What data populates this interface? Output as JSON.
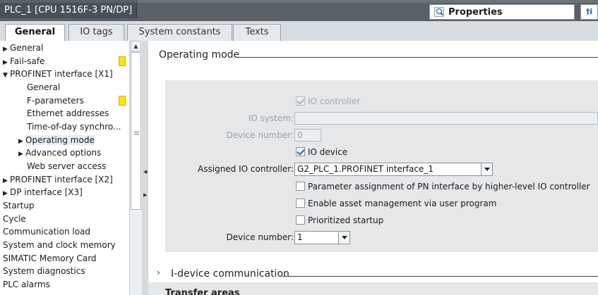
{
  "window": {
    "title": "PLC_1 [CPU 1516F-3 PN/DP]",
    "properties_label": "Properties",
    "info_glyph": "†i"
  },
  "tabs": [
    {
      "label": "General",
      "active": true
    },
    {
      "label": "IO tags",
      "active": false
    },
    {
      "label": "System constants",
      "active": false
    },
    {
      "label": "Texts",
      "active": false
    }
  ],
  "nav": {
    "items": [
      {
        "label": "General",
        "arrow": "▶"
      },
      {
        "label": "Fail-safe",
        "arrow": "▶"
      },
      {
        "label": "PROFINET interface [X1]",
        "arrow": "▼"
      },
      {
        "label": "General",
        "arrow": ""
      },
      {
        "label": "F-parameters",
        "arrow": ""
      },
      {
        "label": "Ethernet addresses",
        "arrow": ""
      },
      {
        "label": "Time-of-day synchro...",
        "arrow": ""
      },
      {
        "label": "Operating mode",
        "arrow": "▶"
      },
      {
        "label": "Advanced options",
        "arrow": "▶"
      },
      {
        "label": "Web server access",
        "arrow": ""
      },
      {
        "label": "PROFINET interface [X2]",
        "arrow": "▶"
      },
      {
        "label": "DP interface [X3]",
        "arrow": "▶"
      },
      {
        "label": "Startup",
        "arrow": ""
      },
      {
        "label": "Cycle",
        "arrow": ""
      },
      {
        "label": "Communication load",
        "arrow": ""
      },
      {
        "label": "System and clock memory",
        "arrow": ""
      },
      {
        "label": "SIMATIC Memory Card",
        "arrow": ""
      },
      {
        "label": "System diagnostics",
        "arrow": ""
      },
      {
        "label": "PLC alarms",
        "arrow": ""
      }
    ]
  },
  "icons": {
    "scroll_up": "▲",
    "splitter_left": "◀",
    "splitter_right": "▶",
    "section_chevron": "›"
  },
  "main": {
    "operating_mode_title": "Operating mode",
    "io_controller_label": "IO controller",
    "io_system_label": "IO system:",
    "io_system_value": "",
    "device_number_label": "Device number:",
    "device_number_value_disabled": "0",
    "io_device_label": "IO device",
    "assigned_io_controller_label": "Assigned IO controller:",
    "assigned_io_controller_value": "G2_PLC_1.PROFINET interface_1",
    "param_assignment_label": "Parameter assignment of PN interface by higher-level IO controller",
    "asset_mgmt_label": "Enable asset management via user program",
    "prioritized_startup_label": "Prioritized startup",
    "device_number2_label": "Device number:",
    "device_number2_value": "1",
    "idevice_comm_title": "I-device communication",
    "transfer_areas_title": "Transfer areas"
  },
  "colors": {
    "warning": "#ffe600",
    "checkbox_accent": "#1f63b5",
    "panel_bg": "#e5e7e9"
  }
}
